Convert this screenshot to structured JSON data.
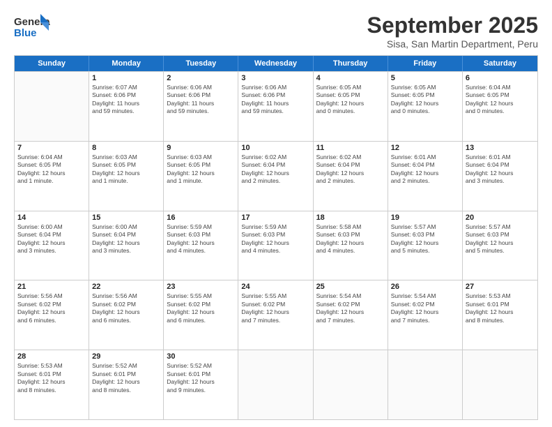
{
  "logo": {
    "line1": "General",
    "line2": "Blue"
  },
  "title": "September 2025",
  "subtitle": "Sisa, San Martin Department, Peru",
  "days_of_week": [
    "Sunday",
    "Monday",
    "Tuesday",
    "Wednesday",
    "Thursday",
    "Friday",
    "Saturday"
  ],
  "weeks": [
    [
      {
        "day": "",
        "info": ""
      },
      {
        "day": "1",
        "info": "Sunrise: 6:07 AM\nSunset: 6:06 PM\nDaylight: 11 hours\nand 59 minutes."
      },
      {
        "day": "2",
        "info": "Sunrise: 6:06 AM\nSunset: 6:06 PM\nDaylight: 11 hours\nand 59 minutes."
      },
      {
        "day": "3",
        "info": "Sunrise: 6:06 AM\nSunset: 6:06 PM\nDaylight: 11 hours\nand 59 minutes."
      },
      {
        "day": "4",
        "info": "Sunrise: 6:05 AM\nSunset: 6:05 PM\nDaylight: 12 hours\nand 0 minutes."
      },
      {
        "day": "5",
        "info": "Sunrise: 6:05 AM\nSunset: 6:05 PM\nDaylight: 12 hours\nand 0 minutes."
      },
      {
        "day": "6",
        "info": "Sunrise: 6:04 AM\nSunset: 6:05 PM\nDaylight: 12 hours\nand 0 minutes."
      }
    ],
    [
      {
        "day": "7",
        "info": "Sunrise: 6:04 AM\nSunset: 6:05 PM\nDaylight: 12 hours\nand 1 minute."
      },
      {
        "day": "8",
        "info": "Sunrise: 6:03 AM\nSunset: 6:05 PM\nDaylight: 12 hours\nand 1 minute."
      },
      {
        "day": "9",
        "info": "Sunrise: 6:03 AM\nSunset: 6:05 PM\nDaylight: 12 hours\nand 1 minute."
      },
      {
        "day": "10",
        "info": "Sunrise: 6:02 AM\nSunset: 6:04 PM\nDaylight: 12 hours\nand 2 minutes."
      },
      {
        "day": "11",
        "info": "Sunrise: 6:02 AM\nSunset: 6:04 PM\nDaylight: 12 hours\nand 2 minutes."
      },
      {
        "day": "12",
        "info": "Sunrise: 6:01 AM\nSunset: 6:04 PM\nDaylight: 12 hours\nand 2 minutes."
      },
      {
        "day": "13",
        "info": "Sunrise: 6:01 AM\nSunset: 6:04 PM\nDaylight: 12 hours\nand 3 minutes."
      }
    ],
    [
      {
        "day": "14",
        "info": "Sunrise: 6:00 AM\nSunset: 6:04 PM\nDaylight: 12 hours\nand 3 minutes."
      },
      {
        "day": "15",
        "info": "Sunrise: 6:00 AM\nSunset: 6:04 PM\nDaylight: 12 hours\nand 3 minutes."
      },
      {
        "day": "16",
        "info": "Sunrise: 5:59 AM\nSunset: 6:03 PM\nDaylight: 12 hours\nand 4 minutes."
      },
      {
        "day": "17",
        "info": "Sunrise: 5:59 AM\nSunset: 6:03 PM\nDaylight: 12 hours\nand 4 minutes."
      },
      {
        "day": "18",
        "info": "Sunrise: 5:58 AM\nSunset: 6:03 PM\nDaylight: 12 hours\nand 4 minutes."
      },
      {
        "day": "19",
        "info": "Sunrise: 5:57 AM\nSunset: 6:03 PM\nDaylight: 12 hours\nand 5 minutes."
      },
      {
        "day": "20",
        "info": "Sunrise: 5:57 AM\nSunset: 6:03 PM\nDaylight: 12 hours\nand 5 minutes."
      }
    ],
    [
      {
        "day": "21",
        "info": "Sunrise: 5:56 AM\nSunset: 6:02 PM\nDaylight: 12 hours\nand 6 minutes."
      },
      {
        "day": "22",
        "info": "Sunrise: 5:56 AM\nSunset: 6:02 PM\nDaylight: 12 hours\nand 6 minutes."
      },
      {
        "day": "23",
        "info": "Sunrise: 5:55 AM\nSunset: 6:02 PM\nDaylight: 12 hours\nand 6 minutes."
      },
      {
        "day": "24",
        "info": "Sunrise: 5:55 AM\nSunset: 6:02 PM\nDaylight: 12 hours\nand 7 minutes."
      },
      {
        "day": "25",
        "info": "Sunrise: 5:54 AM\nSunset: 6:02 PM\nDaylight: 12 hours\nand 7 minutes."
      },
      {
        "day": "26",
        "info": "Sunrise: 5:54 AM\nSunset: 6:02 PM\nDaylight: 12 hours\nand 7 minutes."
      },
      {
        "day": "27",
        "info": "Sunrise: 5:53 AM\nSunset: 6:01 PM\nDaylight: 12 hours\nand 8 minutes."
      }
    ],
    [
      {
        "day": "28",
        "info": "Sunrise: 5:53 AM\nSunset: 6:01 PM\nDaylight: 12 hours\nand 8 minutes."
      },
      {
        "day": "29",
        "info": "Sunrise: 5:52 AM\nSunset: 6:01 PM\nDaylight: 12 hours\nand 8 minutes."
      },
      {
        "day": "30",
        "info": "Sunrise: 5:52 AM\nSunset: 6:01 PM\nDaylight: 12 hours\nand 9 minutes."
      },
      {
        "day": "",
        "info": ""
      },
      {
        "day": "",
        "info": ""
      },
      {
        "day": "",
        "info": ""
      },
      {
        "day": "",
        "info": ""
      }
    ]
  ]
}
